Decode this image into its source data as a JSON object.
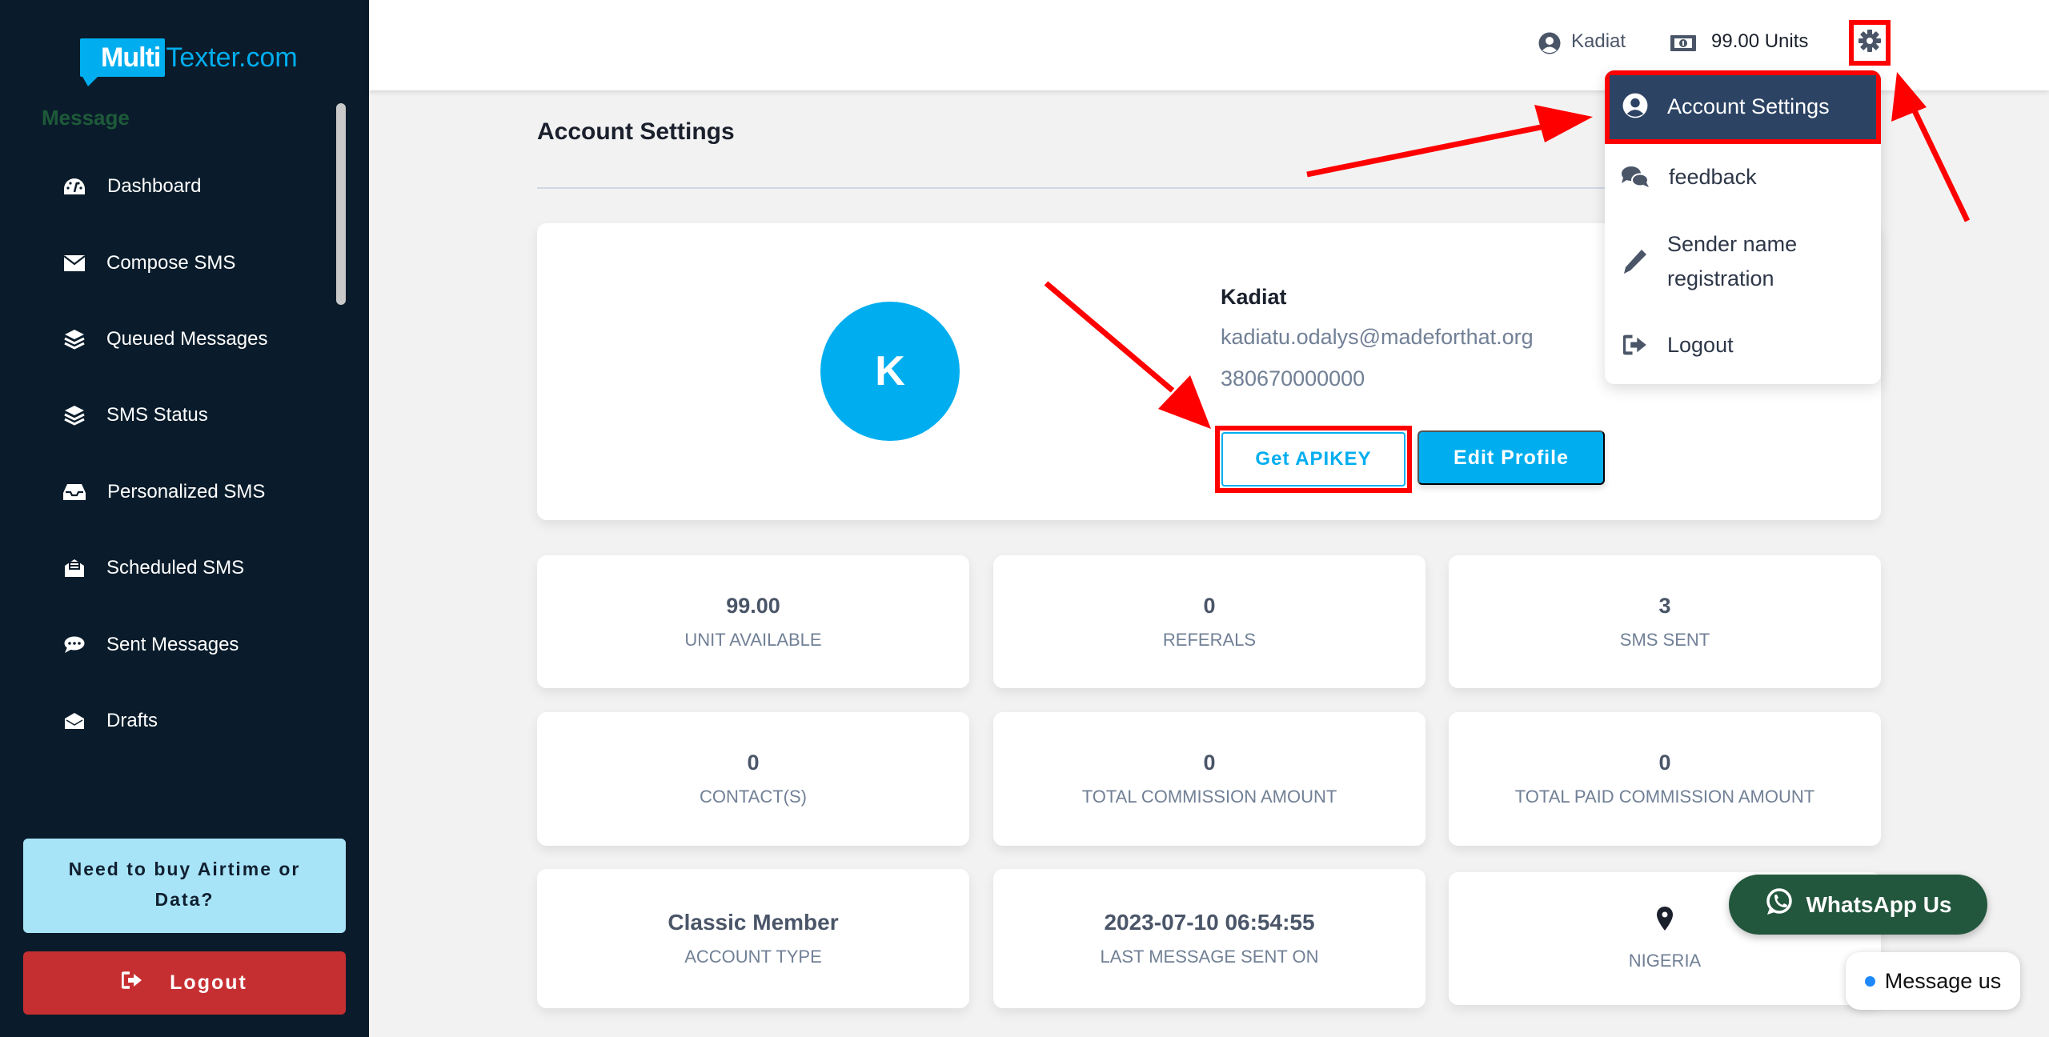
{
  "brand": {
    "logo_bold": "Multi",
    "logo_rest": "Texter.com"
  },
  "sidebar": {
    "section_label": "Message",
    "items": [
      {
        "label": "Dashboard",
        "icon": "dashboard-gauge-icon"
      },
      {
        "label": "Compose SMS",
        "icon": "envelope-icon"
      },
      {
        "label": "Queued Messages",
        "icon": "layers-icon"
      },
      {
        "label": "SMS Status",
        "icon": "layers-icon"
      },
      {
        "label": "Personalized SMS",
        "icon": "inbox-icon"
      },
      {
        "label": "Scheduled SMS",
        "icon": "envelope-open-text-icon"
      },
      {
        "label": "Sent Messages",
        "icon": "comment-dots-icon"
      },
      {
        "label": "Drafts",
        "icon": "envelope-open-icon"
      }
    ],
    "airtime_promo": "Need to buy Airtime or Data?",
    "logout_label": "Logout"
  },
  "header": {
    "username": "Kadiat",
    "units": "99.00 Units"
  },
  "page": {
    "title": "Account Settings"
  },
  "profile": {
    "initial": "K",
    "name": "Kadiat",
    "email": "kadiatu.odalys@madeforthat.org",
    "phone": "380670000000",
    "get_apikey_label": "Get APIKEY",
    "edit_profile_label": "Edit Profile"
  },
  "stats": [
    {
      "value": "99.00",
      "label": "UNIT AVAILABLE"
    },
    {
      "value": "0",
      "label": "REFERALS"
    },
    {
      "value": "3",
      "label": "SMS SENT"
    },
    {
      "value": "0",
      "label": "CONTACT(S)"
    },
    {
      "value": "0",
      "label": "TOTAL COMMISSION AMOUNT"
    },
    {
      "value": "0",
      "label": "TOTAL PAID COMMISSION AMOUNT"
    },
    {
      "value": "Classic Member",
      "label": "ACCOUNT TYPE"
    },
    {
      "value": "2023-07-10 06:54:55",
      "label": "LAST MESSAGE SENT ON"
    },
    {
      "value": "",
      "label": "NIGERIA",
      "icon": "map-pin-icon"
    }
  ],
  "dropdown": {
    "items": [
      {
        "label": "Account Settings",
        "icon": "user-circle-icon",
        "active": true
      },
      {
        "label": "feedback",
        "icon": "comments-icon"
      },
      {
        "label": "Sender name registration",
        "icon": "pencil-icon"
      },
      {
        "label": "Logout",
        "icon": "sign-out-icon"
      }
    ]
  },
  "floating": {
    "whatsapp_label": "WhatsApp Us",
    "message_us_label": "Message us"
  },
  "colors": {
    "sidebar_bg": "#0a1c2b",
    "brand_blue": "#00aeef",
    "logout_red": "#c62f32",
    "airtime_bg": "#a8e4f8",
    "dropdown_active": "#2c4364",
    "whatsapp_green": "#23573d",
    "annotation_red": "#ff0000"
  }
}
